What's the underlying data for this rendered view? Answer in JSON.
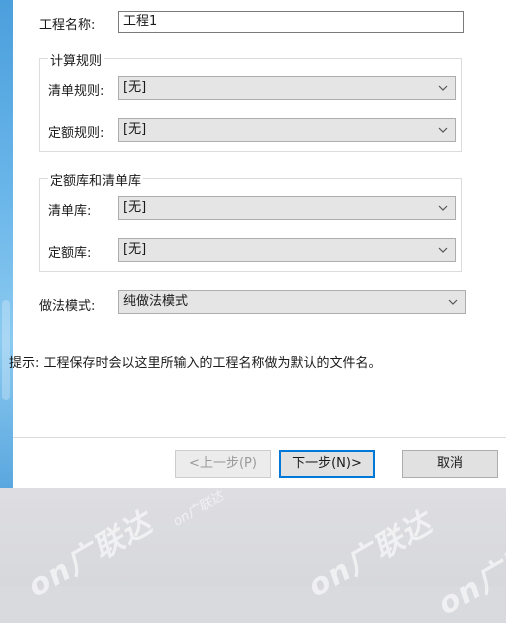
{
  "project": {
    "name_label": "工程名称:",
    "name_value": "工程1"
  },
  "calc_rules": {
    "group_title": "计算规则",
    "list_rule_label": "清单规则:",
    "list_rule_value": "[无]",
    "quota_rule_label": "定额规则:",
    "quota_rule_value": "[无]"
  },
  "libraries": {
    "group_title": "定额库和清单库",
    "list_lib_label": "清单库:",
    "list_lib_value": "[无]",
    "quota_lib_label": "定额库:",
    "quota_lib_value": "[无]"
  },
  "method_mode": {
    "label": "做法模式:",
    "value": "纯做法模式"
  },
  "hint": "提示: 工程保存时会以这里所输入的工程名称做为默认的文件名。",
  "buttons": {
    "prev": "<上一步(P)",
    "next": "下一步(N)>",
    "cancel": "取消"
  },
  "watermark": [
    "on广联达",
    "on广联达",
    "on广联达",
    "on广联达"
  ],
  "colors": {
    "accent": "#0078d7",
    "banner_blue": "#5aa7df"
  }
}
